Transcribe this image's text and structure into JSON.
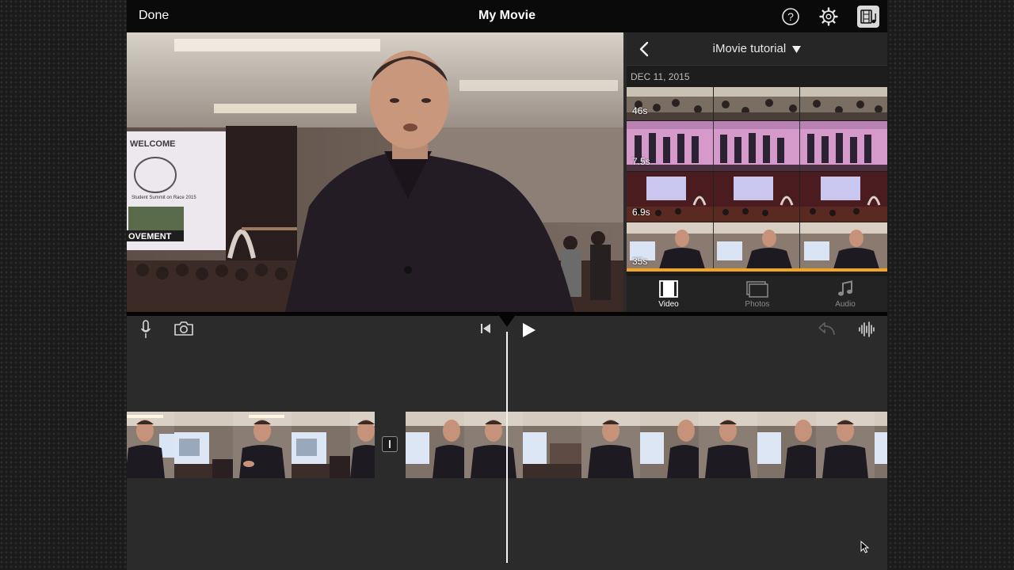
{
  "topbar": {
    "done_label": "Done",
    "title": "My Movie",
    "icons": [
      "help-icon",
      "settings-gear-icon",
      "media-browser-icon"
    ]
  },
  "media_browser": {
    "back_icon": "chevron-left-icon",
    "album_title": "iMovie tutorial",
    "album_dropdown_icon": "triangle-down-icon",
    "date_header": "DEC 11, 2015",
    "clips": [
      {
        "duration": "46s",
        "scene": "crowd at tables"
      },
      {
        "duration": "7.5s",
        "scene": "students on stage"
      },
      {
        "duration": "6.9s",
        "scene": "auditorium stage"
      },
      {
        "duration": "35s",
        "scene": "man talking"
      }
    ],
    "tabs": [
      {
        "label": "Video",
        "icon": "film-strip-icon",
        "selected": true
      },
      {
        "label": "Photos",
        "icon": "photos-icon",
        "selected": false
      },
      {
        "label": "Audio",
        "icon": "music-note-icon",
        "selected": false
      }
    ]
  },
  "viewer": {
    "screen_text_1": "WELCOME",
    "screen_text_2": "Student Summit on Race 2015",
    "screen_text_3": "OVEMENT"
  },
  "timeline_toolbar": {
    "left_icons": [
      "microphone-icon",
      "camera-icon"
    ],
    "center_icons": [
      "skip-to-start-icon",
      "play-icon"
    ],
    "right_icons": [
      "undo-icon",
      "audio-waveform-icon"
    ]
  },
  "colors": {
    "topbar_bg": "#0a0a0a",
    "timeline_bg": "#2b2b2b",
    "browser_bg": "#1d1d1d",
    "selected_tab": "#ffffff",
    "unselected_tab": "#8a8a8a"
  }
}
